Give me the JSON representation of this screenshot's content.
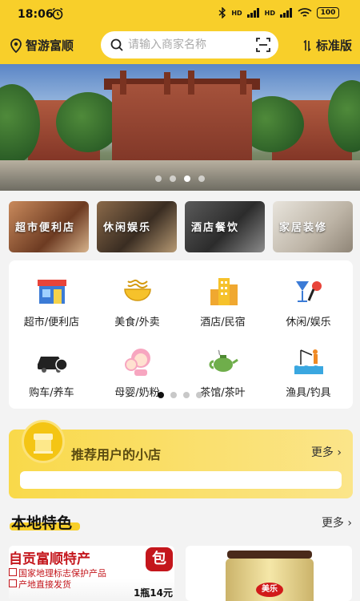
{
  "status": {
    "time": "18:06",
    "battery": "100",
    "network": "HD"
  },
  "header": {
    "location": "智游富顺",
    "search_placeholder": "请输入商家名称",
    "version": "标准版"
  },
  "banner": {
    "slide_count": 4,
    "active_slide": 3
  },
  "category_tiles": [
    {
      "label": "超市便利店"
    },
    {
      "label": "休闲娱乐"
    },
    {
      "label": "酒店餐饮"
    },
    {
      "label": "家居装修"
    }
  ],
  "categories": [
    {
      "label": "超市/便利店",
      "icon": "supermarket-icon"
    },
    {
      "label": "美食/外卖",
      "icon": "noodle-bowl-icon"
    },
    {
      "label": "酒店/民宿",
      "icon": "hotel-building-icon"
    },
    {
      "label": "休闲/娱乐",
      "icon": "cocktail-mic-icon"
    },
    {
      "label": "购车/养车",
      "icon": "car-rental-icon"
    },
    {
      "label": "母婴/奶粉",
      "icon": "mother-baby-icon"
    },
    {
      "label": "茶馆/茶叶",
      "icon": "teapot-icon"
    },
    {
      "label": "渔具/钓具",
      "icon": "fishing-icon"
    }
  ],
  "recommend": {
    "title": "推荐用户的小店",
    "more": "更多"
  },
  "local": {
    "title": "本地特色",
    "more": "更多"
  },
  "products": {
    "p1_title": "自贡富顺特产",
    "p1_line1": "国家地理标志保护产品",
    "p1_line2": "产地直接发货",
    "p1_badge": "包",
    "p1_price": "1瓶14元",
    "p2_brand": "美乐"
  }
}
